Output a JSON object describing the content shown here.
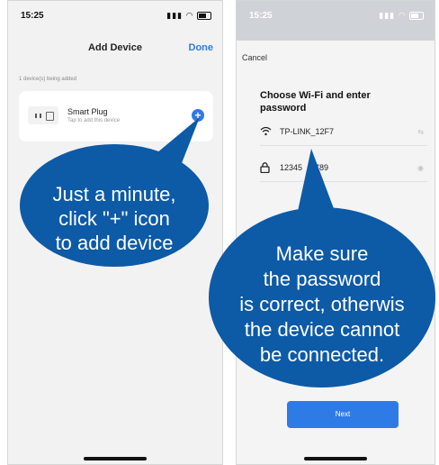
{
  "left_phone": {
    "status_time": "15:25",
    "nav_title": "Add Device",
    "done_label": "Done",
    "adding_count_text": "1 device(s) being added",
    "device": {
      "name": "Smart Plug",
      "subtitle": "Tap to add this device",
      "add_symbol": "+"
    },
    "callout_lines": [
      "Just a minute,",
      "click \"+\" icon",
      "to add device"
    ]
  },
  "right_phone": {
    "status_time": "15:25",
    "cancel_label": "Cancel",
    "heading": "Choose Wi-Fi and enter password",
    "wifi_name": "TP-LINK_12F7",
    "password": "12345",
    "password_tail": "789",
    "next_label": "Next",
    "callout_lines": [
      "Make sure",
      "the password",
      "is correct, otherwis",
      "the device cannot",
      "be connected."
    ]
  },
  "icons": {
    "wifi": "wifi-icon",
    "lock": "lock-icon",
    "switch": "wifi-switch-icon",
    "eye": "eye-icon"
  },
  "colors": {
    "accent": "#2f7be6",
    "callout": "#0d5aa7"
  }
}
